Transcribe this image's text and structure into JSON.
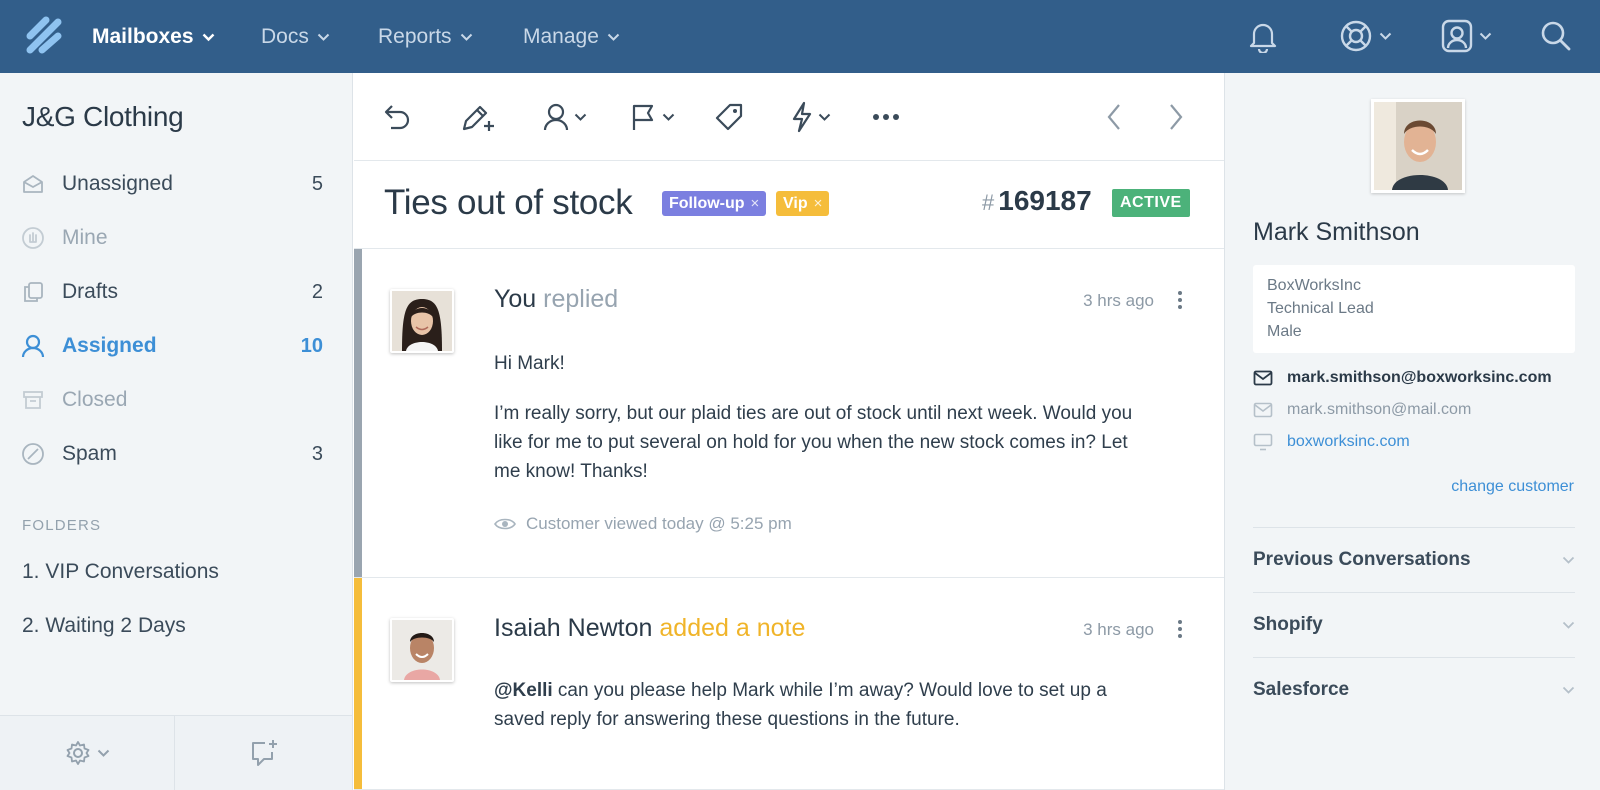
{
  "colors": {
    "nav_bg": "#325e8a",
    "accent": "#3d8fd6",
    "tag_followup": "#7b7fe0",
    "tag_vip": "#f5bd3b",
    "status_active": "#4cb27a",
    "note_bar": "#f5bd3b",
    "reply_bar": "#9aa5b0"
  },
  "topnav": {
    "logo_icon": "helpscout-logo-icon",
    "items": [
      {
        "label": "Mailboxes",
        "active": true
      },
      {
        "label": "Docs"
      },
      {
        "label": "Reports"
      },
      {
        "label": "Manage"
      }
    ],
    "right_icons": [
      "bell-icon",
      "lifebuoy-icon",
      "user-profile-icon",
      "search-icon"
    ]
  },
  "sidebar": {
    "mailbox_name": "J&G Clothing",
    "items": [
      {
        "label": "Unassigned",
        "count": "5",
        "icon": "inbox-icon"
      },
      {
        "label": "Mine",
        "count": "",
        "icon": "hand-icon"
      },
      {
        "label": "Drafts",
        "count": "2",
        "icon": "drafts-icon"
      },
      {
        "label": "Assigned",
        "count": "10",
        "icon": "user-icon",
        "selected": true
      },
      {
        "label": "Closed",
        "count": "",
        "icon": "archive-icon"
      },
      {
        "label": "Spam",
        "count": "3",
        "icon": "ban-icon"
      }
    ],
    "folders_heading": "FOLDERS",
    "folders": [
      "1. VIP Conversations",
      "2. Waiting 2 Days"
    ],
    "footer_icons": [
      "gear-icon",
      "new-conversation-icon"
    ]
  },
  "toolbar": {
    "icons": [
      "reply-icon",
      "note-pencil-icon",
      "assign-user-icon",
      "flag-status-icon",
      "tag-icon",
      "workflow-bolt-icon",
      "more-icon",
      "prev-arrow-icon",
      "next-arrow-icon"
    ]
  },
  "conversation": {
    "title": "Ties out of stock",
    "tags": [
      {
        "label": "Follow-up",
        "remove": "×"
      },
      {
        "label": "Vip",
        "remove": "×"
      }
    ],
    "number_prefix": "#",
    "number": "169187",
    "status": "ACTIVE"
  },
  "threads": [
    {
      "author": "You",
      "action": "replied",
      "time": "3 hrs ago",
      "greeting": "Hi Mark!",
      "body": "I’m really sorry, but our plaid ties are out of stock until next week. Would you like for me to put several on hold for you when the new stock comes in? Let me know! Thanks!",
      "viewed": "Customer viewed today @ 5:25 pm"
    },
    {
      "author": "Isaiah Newton",
      "action": "added a note",
      "time": "3 hrs ago",
      "mention": "@Kelli",
      "body": " can you please help Mark while I’m away? Would love to set up a saved reply for answering these questions in the future."
    }
  ],
  "customer": {
    "name": "Mark Smithson",
    "company": "BoxWorksInc",
    "job_title": "Technical Lead",
    "gender": "Male",
    "email_primary": "mark.smithson@boxworksinc.com",
    "email_secondary": "mark.smithson@mail.com",
    "website": "boxworksinc.com",
    "change_link": "change customer"
  },
  "apps": [
    "Previous Conversations",
    "Shopify",
    "Salesforce"
  ]
}
